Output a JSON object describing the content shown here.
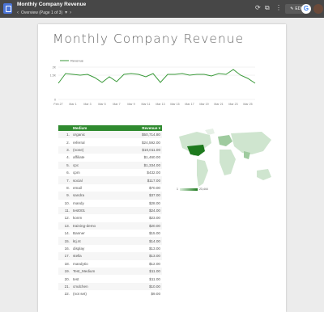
{
  "app": {
    "title": "Monthly Company Revenue",
    "nav_label": "Overview (Page 1 of 3)",
    "edit_label": "EDIT",
    "google_letter": "G"
  },
  "report": {
    "title": "Monthly Company Revenue"
  },
  "colors": {
    "topbar": "#474747",
    "accent_green": "#2f8a2f",
    "line_green": "#3a9a3a"
  },
  "icons": [
    "refresh-icon",
    "copy-icon",
    "more-vert-icon",
    "pencil-icon",
    "chevron-left-icon",
    "chevron-right-icon"
  ],
  "chart_data": [
    {
      "type": "line",
      "legend": "Revenue",
      "x": [
        "Feb 27",
        "Feb 28",
        "Mar 1",
        "Mar 2",
        "Mar 3",
        "Mar 4",
        "Mar 5",
        "Mar 6",
        "Mar 7",
        "Mar 8",
        "Mar 9",
        "Mar 10",
        "Mar 11",
        "Mar 12",
        "Mar 13",
        "Mar 14",
        "Mar 15",
        "Mar 16",
        "Mar 17",
        "Mar 18",
        "Mar 19",
        "Mar 20",
        "Mar 21",
        "Mar 22",
        "Mar 23",
        "Mar 24",
        "Mar 25",
        "Mar 26"
      ],
      "x_tick_labels": [
        "Feb 27",
        "Mar 1",
        "Mar 3",
        "Mar 5",
        "Mar 7",
        "Mar 9",
        "Mar 11",
        "Mar 13",
        "Mar 15",
        "Mar 17",
        "Mar 19",
        "Mar 21",
        "Mar 23",
        "Mar 25"
      ],
      "series": [
        {
          "name": "Revenue",
          "values": [
            1.0,
            1.6,
            1.55,
            1.5,
            1.55,
            1.35,
            1.05,
            1.4,
            1.1,
            1.55,
            1.6,
            1.55,
            1.4,
            1.6,
            1.05,
            1.55,
            1.55,
            1.6,
            1.5,
            1.55,
            1.55,
            1.45,
            1.6,
            1.55,
            1.85,
            1.5,
            1.3,
            1.0
          ]
        }
      ],
      "y_tick_labels": [
        "2K",
        "1.5K",
        "0"
      ],
      "ylim": [
        0,
        2
      ],
      "legend_position": "top-left"
    },
    {
      "type": "table",
      "columns": [
        "Medium",
        "Revenue ▾"
      ],
      "rows": [
        [
          "1.",
          "organic",
          "$50,714.80"
        ],
        [
          "2.",
          "referral",
          "$24,592.00"
        ],
        [
          "3.",
          "(none)",
          "$10,011.00"
        ],
        [
          "4.",
          "affiliate",
          "$1,460.00"
        ],
        [
          "5.",
          "cpc",
          "$1,334.00"
        ],
        [
          "6.",
          "cpm",
          "$432.00"
        ],
        [
          "7.",
          "social",
          "$117.00"
        ],
        [
          "8.",
          "email",
          "$70.00"
        ],
        [
          "9.",
          "sandra",
          "$37.00"
        ],
        [
          "10.",
          "mandy",
          "$28.00"
        ],
        [
          "11.",
          "test001",
          "$24.00"
        ],
        [
          "12.",
          "konm",
          "$23.00"
        ],
        [
          "13.",
          "training-demo",
          "$20.00"
        ],
        [
          "14.",
          "Banner",
          "$15.00"
        ],
        [
          "15.",
          "ktj.nt",
          "$14.00"
        ],
        [
          "16.",
          "display",
          "$13.00"
        ],
        [
          "17.",
          "stella",
          "$13.00"
        ],
        [
          "18.",
          "mandytio",
          "$12.00"
        ],
        [
          "19.",
          "Test_Medium",
          "$11.00"
        ],
        [
          "20.",
          "test",
          "$11.00"
        ],
        [
          "21.",
          "cmdchen",
          "$10.00"
        ],
        [
          "22.",
          "(not set)",
          "$9.00"
        ]
      ]
    },
    {
      "type": "heatmap",
      "map": "world",
      "legend_min": "1",
      "legend_max": "23,444"
    }
  ]
}
